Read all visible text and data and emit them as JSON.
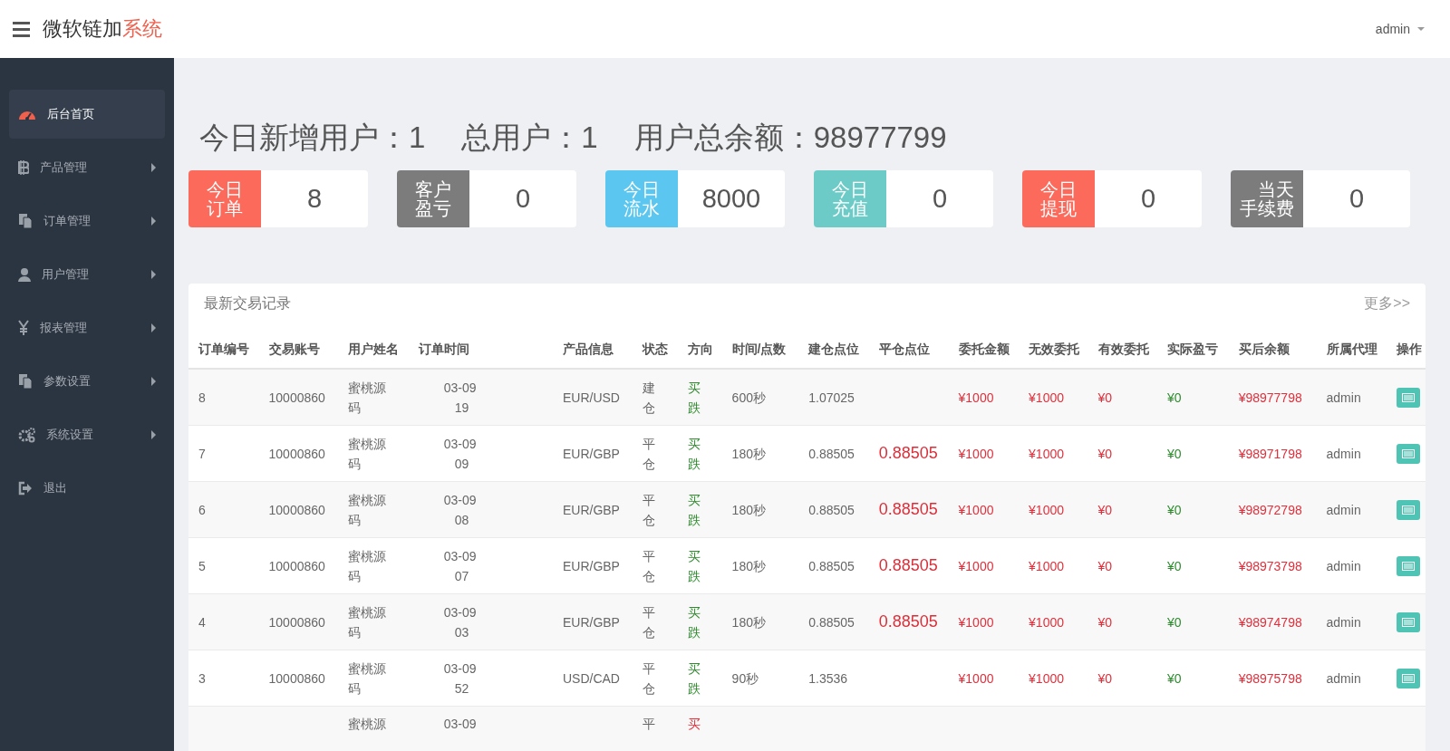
{
  "header": {
    "brand": "微软链加",
    "brand_accent": "系统",
    "user": "admin"
  },
  "sidebar": {
    "items": [
      {
        "label": "后台首页",
        "selected": true,
        "has_submenu": false
      },
      {
        "label": "产品管理",
        "selected": false,
        "has_submenu": true
      },
      {
        "label": "订单管理",
        "selected": false,
        "has_submenu": true
      },
      {
        "label": "用户管理",
        "selected": false,
        "has_submenu": true
      },
      {
        "label": "报表管理",
        "selected": false,
        "has_submenu": true
      },
      {
        "label": "参数设置",
        "selected": false,
        "has_submenu": true
      },
      {
        "label": "系统设置",
        "selected": false,
        "has_submenu": true
      },
      {
        "label": "退出",
        "selected": false,
        "has_submenu": false
      }
    ]
  },
  "summary": [
    {
      "label": "今日新增用户：",
      "value": "1"
    },
    {
      "label": "总用户：",
      "value": "1"
    },
    {
      "label": "用户总余额：",
      "value": "98977799"
    }
  ],
  "stats": [
    {
      "label": "今日订单",
      "value": "8",
      "color": "#fc6a5b"
    },
    {
      "label": "客户盈亏",
      "value": "0",
      "color": "#7c7c7c"
    },
    {
      "label": "今日流水",
      "value": "8000",
      "color": "#5bc6ef"
    },
    {
      "label": "今日充值",
      "value": "0",
      "color": "#6ccbc7"
    },
    {
      "label": "今日提现",
      "value": "0",
      "color": "#fc6a5b"
    },
    {
      "label": "当天手续费",
      "value": "0",
      "color": "#7c7c7c"
    }
  ],
  "table": {
    "title": "最新交易记录",
    "more_link": "更多>>",
    "columns": [
      "订单编号",
      "交易账号",
      "用户姓名",
      "订单时间",
      "产品信息",
      "状态",
      "方向",
      "时间/点数",
      "建仓点位",
      "平仓点位",
      "委托金额",
      "无效委托",
      "有效委托",
      "实际盈亏",
      "买后余额",
      "所属代理",
      "操作"
    ],
    "rows": [
      {
        "kind": "full",
        "order_no": "8",
        "account": "10000860",
        "name": "蜜桃源码",
        "time_date": "03-09",
        "time_clock": "19",
        "product": "EUR/USD",
        "status": "建仓",
        "direction": "买跌",
        "color": "#2e8b2e",
        "duration": "600秒",
        "open_price": "1.07025",
        "amount": "¥1000",
        "invalid": "¥1000",
        "valid": "¥0",
        "profit": "¥0",
        "balance": "¥98977798",
        "agent": "admin"
      },
      {
        "kind": "full",
        "order_no": "7",
        "account": "10000860",
        "name": "蜜桃源码",
        "time_date": "03-09",
        "time_clock": "09",
        "product": "EUR/GBP",
        "status": "平仓",
        "direction": "买跌",
        "color": "#2e8b2e",
        "duration": "180秒",
        "open_price": "0.88505",
        "close_price": "0.88505",
        "amount": "¥1000",
        "invalid": "¥1000",
        "valid": "¥0",
        "profit": "¥0",
        "balance": "¥98971798",
        "agent": "admin"
      },
      {
        "kind": "full",
        "order_no": "6",
        "account": "10000860",
        "name": "蜜桃源码",
        "time_date": "03-09",
        "time_clock": "08",
        "product": "EUR/GBP",
        "status": "平仓",
        "direction": "买跌",
        "color": "#2e8b2e",
        "duration": "180秒",
        "open_price": "0.88505",
        "close_price": "0.88505",
        "amount": "¥1000",
        "invalid": "¥1000",
        "valid": "¥0",
        "profit": "¥0",
        "balance": "¥98972798",
        "agent": "admin"
      },
      {
        "kind": "full",
        "order_no": "5",
        "account": "10000860",
        "name": "蜜桃源码",
        "time_date": "03-09",
        "time_clock": "07",
        "product": "EUR/GBP",
        "status": "平仓",
        "direction": "买跌",
        "color": "#2e8b2e",
        "duration": "180秒",
        "open_price": "0.88505",
        "close_price": "0.88505",
        "amount": "¥1000",
        "invalid": "¥1000",
        "valid": "¥0",
        "profit": "¥0",
        "balance": "¥98973798",
        "agent": "admin"
      },
      {
        "kind": "full",
        "order_no": "4",
        "account": "10000860",
        "name": "蜜桃源码",
        "time_date": "03-09",
        "time_clock": "03",
        "product": "EUR/GBP",
        "status": "平仓",
        "direction": "买跌",
        "color": "#2e8b2e",
        "duration": "180秒",
        "open_price": "0.88505",
        "close_price": "0.88505",
        "amount": "¥1000",
        "invalid": "¥1000",
        "valid": "¥0",
        "profit": "¥0",
        "balance": "¥98974798",
        "agent": "admin"
      },
      {
        "kind": "full",
        "order_no": "3",
        "account": "10000860",
        "name": "蜜桃源码",
        "time_date": "03-09",
        "time_clock": "52",
        "product": "USD/CAD",
        "status": "平仓",
        "direction": "买跌",
        "color": "#2e8b2e",
        "duration": "90秒",
        "open_price": "1.3536",
        "amount": "¥1000",
        "invalid": "¥1000",
        "valid": "¥0",
        "profit": "¥0",
        "balance": "¥98975798",
        "agent": "admin"
      },
      {
        "kind": "partial",
        "name": "蜜桃源",
        "time_date": "03-09",
        "status": "平",
        "direction": "买",
        "color": "#e0303c"
      }
    ]
  }
}
